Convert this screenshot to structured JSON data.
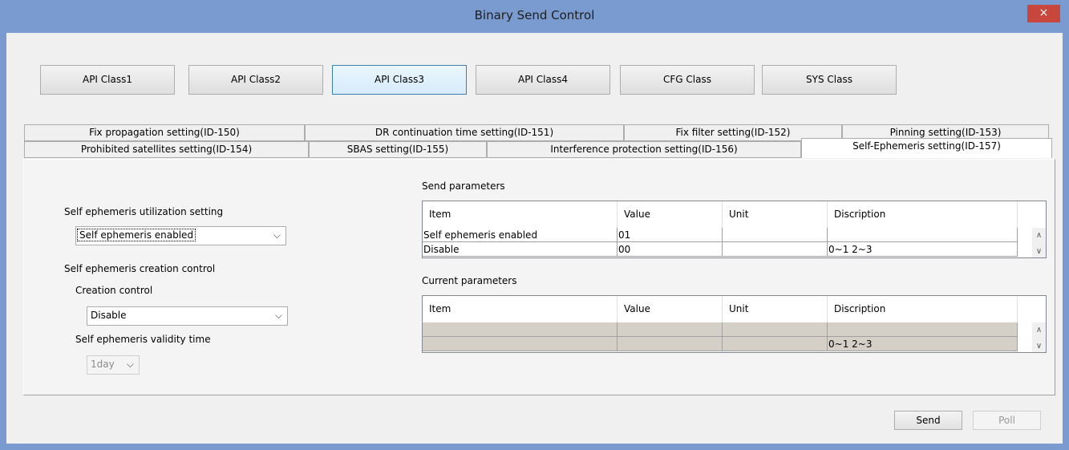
{
  "window": {
    "title": "Binary Send Control",
    "close_glyph": "×"
  },
  "class_buttons": [
    "API Class1",
    "API Class2",
    "API Class3",
    "API Class4",
    "CFG Class",
    "SYS Class"
  ],
  "active_class": "API Class3",
  "tabs_row1": [
    "Fix propagation setting(ID-150)",
    "DR continuation time setting(ID-151)",
    "Fix filter setting(ID-152)",
    "Pinning setting(ID-153)"
  ],
  "tabs_row2": [
    "Prohibited satellites setting(ID-154)",
    "SBAS setting(ID-155)",
    "Interference protection setting(ID-156)",
    "Self-Ephemeris setting(ID-157)"
  ],
  "selected_tab": "Self-Ephemeris setting(ID-157)",
  "left": {
    "utilization_label": "Self ephemeris utilization setting",
    "utilization_value": "Self ephemeris enabled",
    "creation_section_label": "Self ephemeris creation control",
    "creation_control_label": "Creation control",
    "creation_control_value": "Disable",
    "validity_label": "Self ephemeris validity time",
    "validity_value": "1day"
  },
  "send_params": {
    "title": "Send parameters",
    "columns": [
      "Item",
      "Value",
      "Unit",
      "Discription"
    ],
    "rows": [
      [
        "Self ephemeris enabled",
        "01",
        "",
        ""
      ],
      [
        "Disable",
        "00",
        "",
        "0~1  2~3"
      ]
    ]
  },
  "current_params": {
    "title": "Current parameters",
    "columns": [
      "Item",
      "Value",
      "Unit",
      "Discription"
    ],
    "rows": [
      [
        "",
        "",
        "",
        ""
      ],
      [
        "",
        "",
        "",
        "0~1  2~3"
      ]
    ]
  },
  "buttons": {
    "send": "Send",
    "poll": "Poll"
  },
  "icons": {
    "combo_arrow": "⌵",
    "scroll_up": "∧",
    "scroll_down": "∨"
  },
  "colors": {
    "titlebar": "#7a9bcf",
    "close": "#c9463d",
    "active_button_border": "#3c7fb1",
    "gray_row": "#d4d0c8"
  }
}
